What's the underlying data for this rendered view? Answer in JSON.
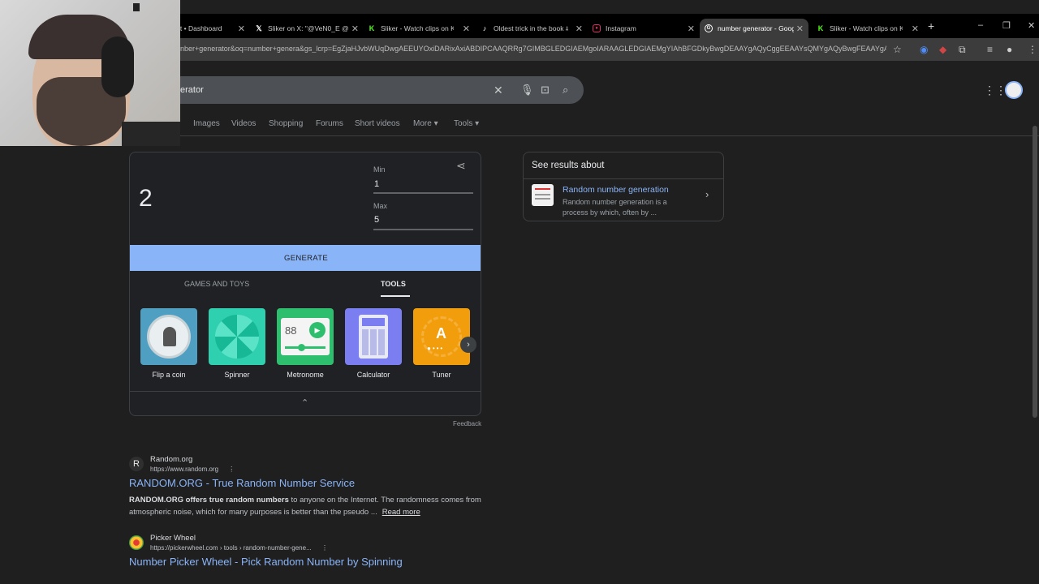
{
  "browser": {
    "tabs": [
      {
        "title": "it • Dashboard",
        "icon": "dashboard-icon",
        "color": "#bbbbbb"
      },
      {
        "title": "Sliker on X: \"@VeN0_E @",
        "icon": "x-logo-icon",
        "color": "#ffffff"
      },
      {
        "title": "Sliker - Watch clips on Ki",
        "icon": "kick-logo-icon",
        "color": "#53fc18"
      },
      {
        "title": "Oldest trick in the book #",
        "icon": "tiktok-logo-icon",
        "color": "#ffffff"
      },
      {
        "title": "Instagram",
        "icon": "instagram-logo-icon",
        "color": "#e1306c"
      },
      {
        "title": "number generator - Goog",
        "icon": "google-logo-icon",
        "color": "#ffffff"
      },
      {
        "title": "Sliker - Watch clips on Ki",
        "icon": "kick-logo-icon",
        "color": "#53fc18"
      }
    ],
    "new_tab": "+",
    "window_controls": {
      "minimize": "–",
      "restore": "❐",
      "close": "✕"
    },
    "url": "nber+generator&oq=number+genera&gs_lcrp=EgZjaHJvbWUqDwgAEEUYOxiDARixAxiABDIPCAAQRRg7GIMBGLEDGIAEMgoIARAAGLEDGIAEMgYIAhBFGDkyBwgDEAAYgAQyCggEEAAYsQMYgAQyBwgFEAAYgAQ..."
  },
  "search": {
    "query": "erator",
    "nav_tabs": [
      "l",
      "Images",
      "Videos",
      "Shopping",
      "Forums",
      "Short videos",
      "More",
      "Tools"
    ]
  },
  "rng": {
    "result": "2",
    "min_label": "Min",
    "min_value": "1",
    "max_label": "Max",
    "max_value": "5",
    "generate_label": "GENERATE",
    "categories": [
      "GAMES AND TOYS",
      "TOOLS"
    ],
    "tools": [
      {
        "label": "Flip a coin",
        "icon": "coin-icon",
        "color": "#5fa8c9"
      },
      {
        "label": "Spinner",
        "icon": "spinner-icon",
        "color": "#3dd6b5"
      },
      {
        "label": "Metronome",
        "icon": "metronome-icon",
        "color": "#2fbf71"
      },
      {
        "label": "Calculator",
        "icon": "calculator-icon",
        "color": "#7b7ef0"
      },
      {
        "label": "Tuner",
        "icon": "tuner-icon",
        "color": "#f29d0b"
      }
    ],
    "metronome_bpm": "88",
    "tuner_note": "A",
    "feedback": "Feedback"
  },
  "knowledge_panel": {
    "heading": "See results about",
    "title": "Random number generation",
    "description": "Random number generation is a process by which, often by ..."
  },
  "results": [
    {
      "site": "Random.org",
      "url": "https://www.random.org",
      "icon_letter": "R",
      "title": "RANDOM.ORG - True Random Number Service",
      "snippet_bold": "RANDOM.ORG offers true random numbers",
      "snippet": " to anyone on the Internet. The randomness comes from atmospheric noise, which for many purposes is better than the pseudo ...",
      "read_more": "Read more"
    },
    {
      "site": "Picker Wheel",
      "url": "https://pickerwheel.com › tools › random-number-gene...",
      "icon_letter": "",
      "title": "Number Picker Wheel - Pick Random Number by Spinning"
    }
  ]
}
